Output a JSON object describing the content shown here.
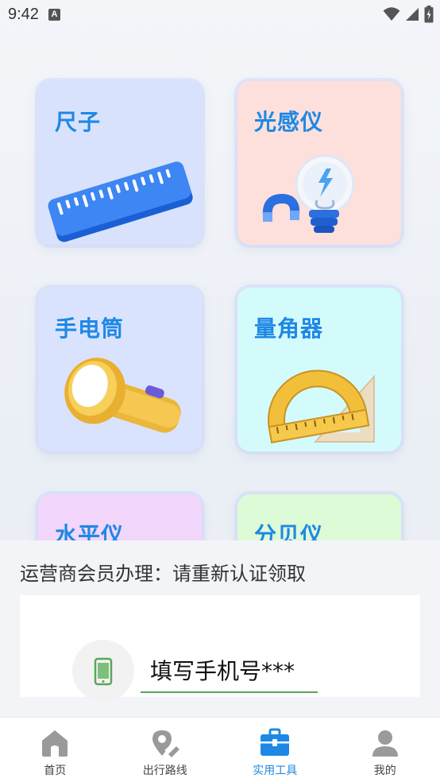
{
  "status_bar": {
    "time": "9:42",
    "a_glyph": "A"
  },
  "cards": [
    {
      "id": "ruler",
      "title": "尺子",
      "bg": "#d9e2fd"
    },
    {
      "id": "light-meter",
      "title": "光感仪",
      "bg": "#fde0dc"
    },
    {
      "id": "flashlight",
      "title": "手电筒",
      "bg": "#dae3fd"
    },
    {
      "id": "protractor",
      "title": "量角器",
      "bg": "#d4fbfc"
    },
    {
      "id": "level",
      "title": "水平仪",
      "bg": "#f2d6fb"
    },
    {
      "id": "decibel",
      "title": "分贝仪",
      "bg": "#ddfbd7"
    }
  ],
  "notice": {
    "text": "运营商会员办理：请重新认证领取",
    "phone_placeholder": "填写手机号***"
  },
  "bottom_nav": [
    {
      "label": "首页",
      "icon": "home-icon",
      "active": false
    },
    {
      "label": "出行路线",
      "icon": "route-icon",
      "active": false
    },
    {
      "label": "实用工具",
      "icon": "toolbox-icon",
      "active": true
    },
    {
      "label": "我的",
      "icon": "user-icon",
      "active": false
    }
  ],
  "colors": {
    "accent": "#1e88e5",
    "inactive_icon": "#9a9a9a"
  }
}
